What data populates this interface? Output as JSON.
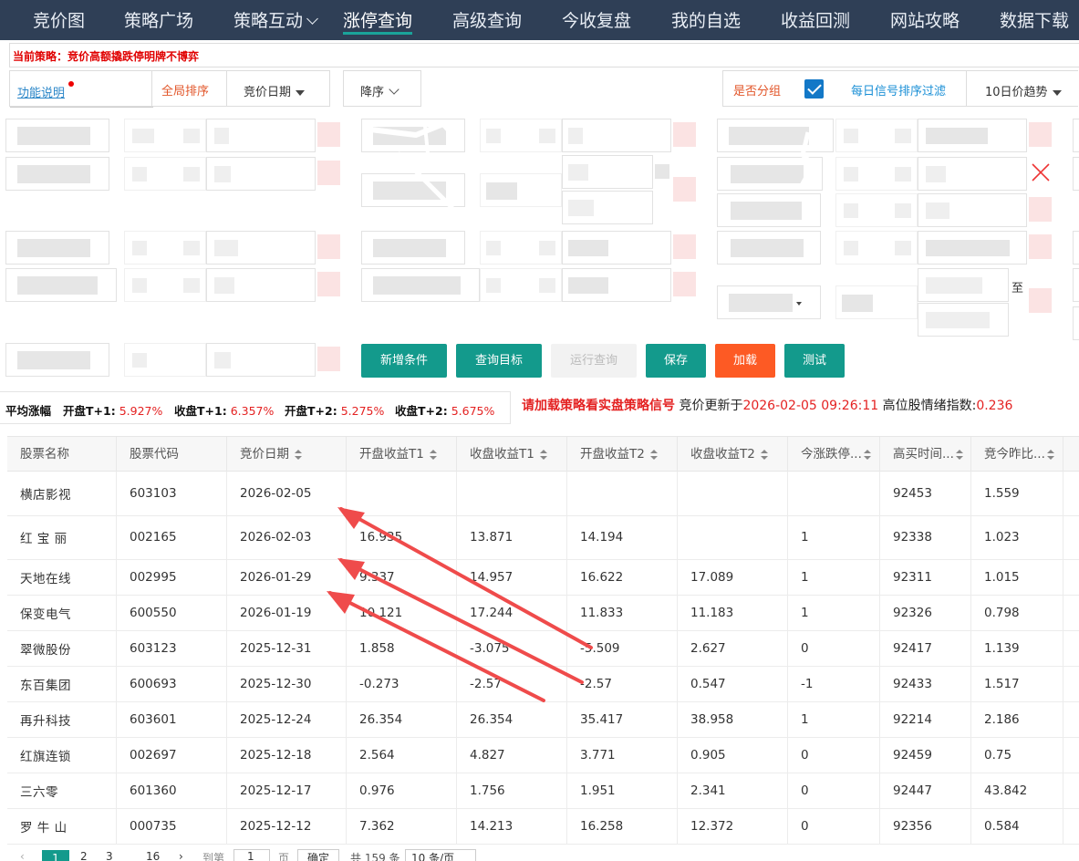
{
  "nav": {
    "items": [
      {
        "label": "竞价图"
      },
      {
        "label": "策略广场"
      },
      {
        "label": "策略互动"
      },
      {
        "label": "涨停查询"
      },
      {
        "label": "高级查询"
      },
      {
        "label": "今收复盘"
      },
      {
        "label": "我的自选"
      },
      {
        "label": "收益回测"
      },
      {
        "label": "网站攻略"
      },
      {
        "label": "数据下载"
      }
    ],
    "active_index": 3
  },
  "strategy": {
    "text": "当前策略：竞价高额撬跌停明牌不博弈"
  },
  "toolbar": {
    "help_label": "功能说明",
    "global_sort_label": "全局排序",
    "sort_field": "竞价日期",
    "sort_order": "降序",
    "group_label": "是否分组",
    "group_checked": true,
    "signal_filter_label": "每日信号排序过滤",
    "trend_select": "10日价趋势"
  },
  "filters": {
    "range_separator": "至"
  },
  "buttons": {
    "add_condition": "新增条件",
    "query_target": "查询目标",
    "run_query": "运行查询",
    "save": "保存",
    "load": "加载",
    "test": "测试"
  },
  "stats": {
    "prefix": "平均涨幅",
    "items": [
      {
        "label": "开盘T+1:",
        "value": "5.927%"
      },
      {
        "label": "收盘T+1:",
        "value": "6.357%"
      },
      {
        "label": "开盘T+2:",
        "value": "5.275%"
      },
      {
        "label": "收盘T+2:",
        "value": "5.675%"
      }
    ]
  },
  "notice": {
    "warning": "请加载策略看实盘策略信号",
    "update_label": "竞价更新于",
    "update_time": "2026-02-05 09:26:11",
    "index_label": "高位股情绪指数:",
    "index_value": "0.236"
  },
  "table": {
    "columns": [
      "股票名称",
      "股票代码",
      "竞价日期",
      "开盘收益T1",
      "收盘收益T1",
      "开盘收益T2",
      "收盘收益T2",
      "今涨跌停...",
      "高买时间...",
      "竞今昨比..."
    ],
    "rows": [
      [
        "横店影视",
        "603103",
        "2026-02-05",
        "",
        "",
        "",
        "",
        "",
        "92453",
        "1.559"
      ],
      [
        "红 宝 丽",
        "002165",
        "2026-02-03",
        "16.935",
        "13.871",
        "14.194",
        "",
        "1",
        "92338",
        "1.023"
      ],
      [
        "天地在线",
        "002995",
        "2026-01-29",
        "9.337",
        "14.957",
        "16.622",
        "17.089",
        "1",
        "92311",
        "1.015"
      ],
      [
        "保变电气",
        "600550",
        "2026-01-19",
        "10.121",
        "17.244",
        "11.833",
        "11.183",
        "1",
        "92326",
        "0.798"
      ],
      [
        "翠微股份",
        "603123",
        "2025-12-31",
        "1.858",
        "-3.075",
        "-5.509",
        "2.627",
        "0",
        "92417",
        "1.139"
      ],
      [
        "东百集团",
        "600693",
        "2025-12-30",
        "-0.273",
        "-2.57",
        "-2.57",
        "0.547",
        "-1",
        "92433",
        "1.517"
      ],
      [
        "再升科技",
        "603601",
        "2025-12-24",
        "26.354",
        "26.354",
        "35.417",
        "38.958",
        "1",
        "92214",
        "2.186"
      ],
      [
        "红旗连锁",
        "002697",
        "2025-12-18",
        "2.564",
        "4.827",
        "3.771",
        "0.905",
        "0",
        "92459",
        "0.75"
      ],
      [
        "三六零",
        "601360",
        "2025-12-17",
        "0.976",
        "1.756",
        "1.951",
        "2.341",
        "0",
        "92447",
        "43.842"
      ],
      [
        "罗 牛 山",
        "000735",
        "2025-12-12",
        "7.362",
        "14.213",
        "16.258",
        "12.372",
        "0",
        "92356",
        "0.584"
      ]
    ]
  },
  "pager": {
    "current": "1",
    "pages": [
      "2",
      "3"
    ],
    "last": "16",
    "goto_label": "到第",
    "goto_value": "1",
    "page_unit": "页",
    "confirm": "确定",
    "total": "共 159 条",
    "page_size": "10 条/页"
  },
  "colors": {
    "nav_bg": "#2f3f56",
    "accent_teal": "#139a8c",
    "accent_orange": "#fd5a24",
    "warning_red": "#e42222",
    "arrow_red": "#ef4b4b"
  }
}
